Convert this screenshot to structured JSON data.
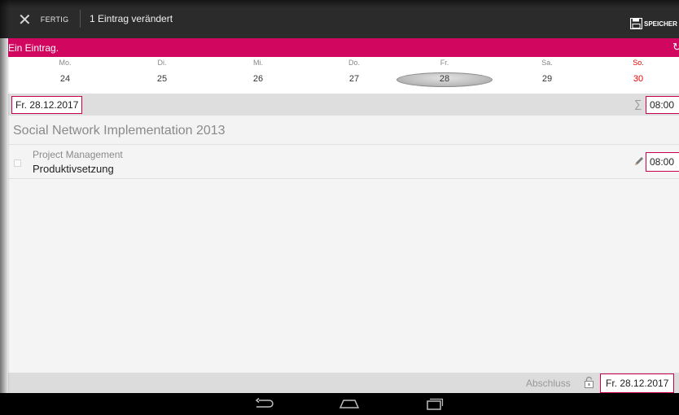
{
  "actionbar": {
    "done_label": "FERTIG",
    "title": "1 Eintrag verändert",
    "save_label": "SPEICHER"
  },
  "banner": {
    "title": "Ein Eintrag.",
    "sync_icon": "sync-icon"
  },
  "week": {
    "days": [
      {
        "name": "Mo.",
        "date": "24"
      },
      {
        "name": "Di.",
        "date": "25"
      },
      {
        "name": "Mi.",
        "date": "26"
      },
      {
        "name": "Do.",
        "date": "27"
      },
      {
        "name": "Fr.",
        "date": "28"
      },
      {
        "name": "Sa.",
        "date": "29"
      },
      {
        "name": "So.",
        "date": "30"
      }
    ],
    "selected_index": 4,
    "weekend_color": "#e60000"
  },
  "datebar": {
    "date": "Fr. 28.12.2017",
    "sum_symbol": "∑",
    "total_time": "08:00"
  },
  "project": {
    "title": "Social Network Implementation 2013"
  },
  "entry": {
    "category": "Project Management",
    "task": "Produktivsetzung",
    "time": "08:00"
  },
  "footer": {
    "label": "Abschluss",
    "date": "Fr. 28.12.2017"
  },
  "colors": {
    "accent": "#d1075f",
    "actionbar": "#2b2b2b"
  }
}
